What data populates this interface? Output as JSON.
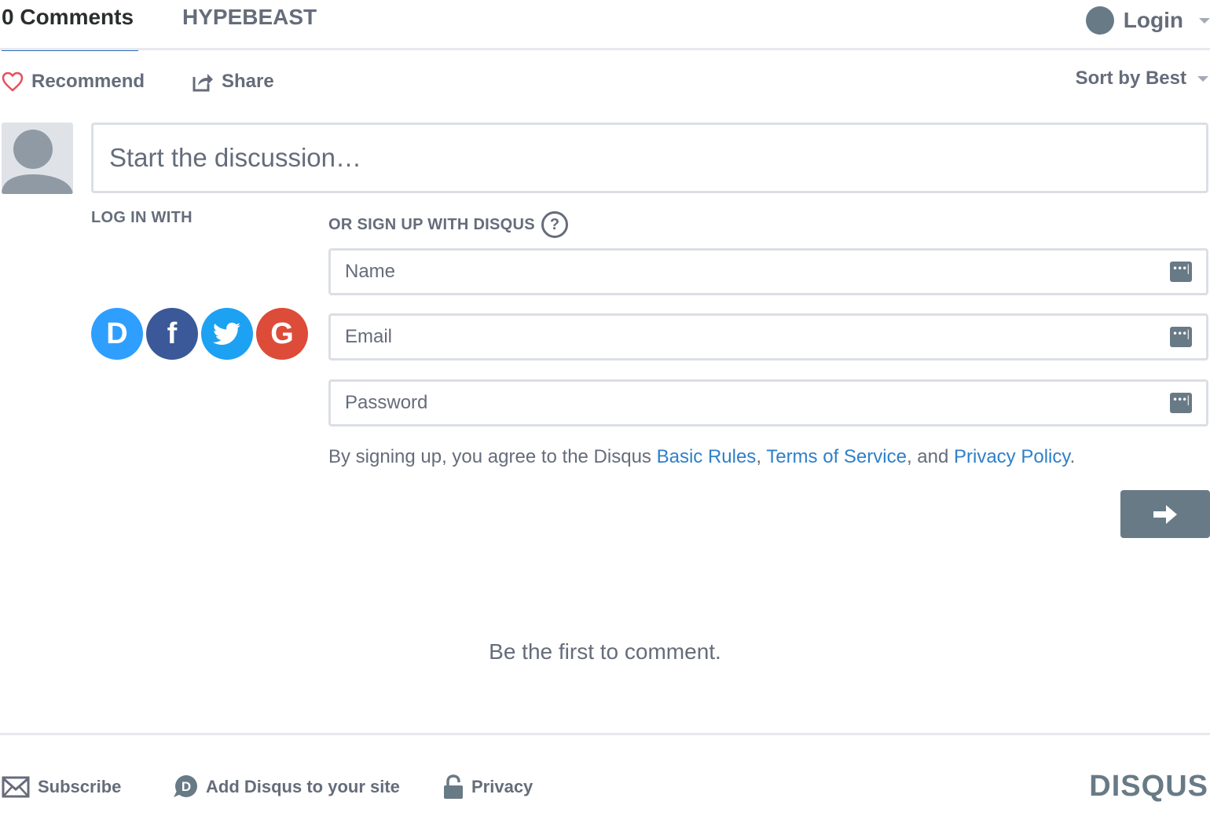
{
  "topnav": {
    "comments_tab": "0 Comments",
    "community_tab": "HYPEBEAST",
    "login_label": "Login"
  },
  "actions": {
    "recommend_label": "Recommend",
    "share_label": "Share",
    "sort_label": "Sort by Best"
  },
  "composer": {
    "placeholder": "Start the discussion…"
  },
  "auth": {
    "login_with_label": "LOG IN WITH",
    "signup_label": "OR SIGN UP WITH DISQUS",
    "help_glyph": "?",
    "social": [
      {
        "name": "disqus",
        "glyph": "D",
        "color": "#2e9fff"
      },
      {
        "name": "facebook",
        "glyph": "f",
        "color": "#3b5998"
      },
      {
        "name": "twitter",
        "glyph": "twitter-bird",
        "color": "#1da1f2"
      },
      {
        "name": "google",
        "glyph": "G",
        "color": "#dd4b39"
      }
    ],
    "fields": {
      "name_placeholder": "Name",
      "email_placeholder": "Email",
      "password_placeholder": "Password"
    },
    "terms": {
      "prefix": "By signing up, you agree to the Disqus ",
      "basic_rules": "Basic Rules",
      "sep1": ", ",
      "tos": "Terms of Service",
      "sep2": ", and ",
      "privacy_policy": "Privacy Policy",
      "suffix": "."
    }
  },
  "empty_state": "Be the first to comment.",
  "footer": {
    "subscribe_label": "Subscribe",
    "add_disqus_label": "Add Disqus to your site",
    "privacy_label": "Privacy",
    "brand": "DISQUS"
  },
  "colors": {
    "accent": "#2e6cb5",
    "link": "#2f80c9",
    "text_muted": "#656c7a",
    "icon_gray": "#687a86",
    "heart": "#e8505b"
  }
}
